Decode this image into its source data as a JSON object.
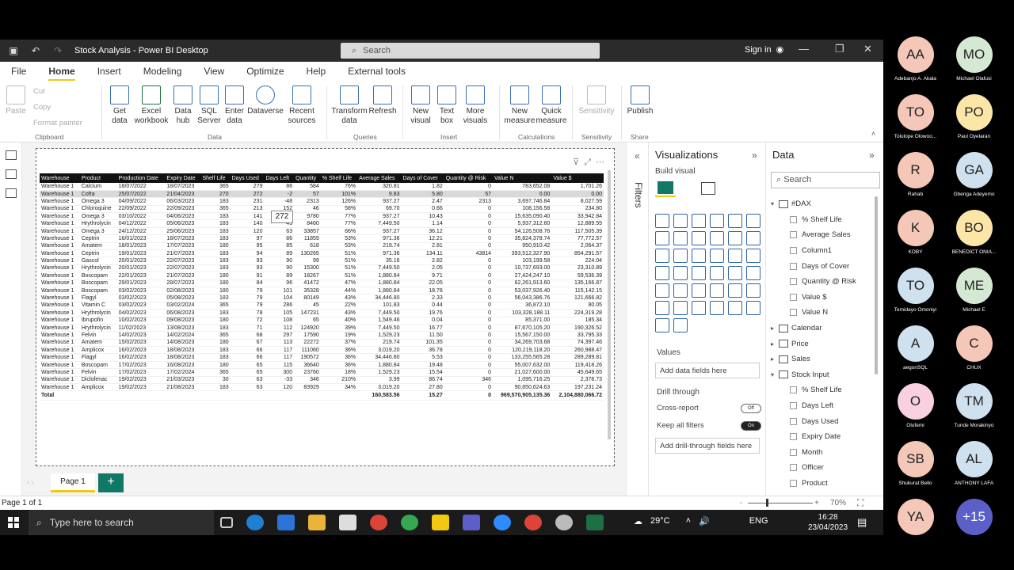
{
  "window": {
    "title": "Stock Analysis - Power BI Desktop",
    "search_placeholder": "Search",
    "signin": "Sign in"
  },
  "menu": [
    "File",
    "Home",
    "Insert",
    "Modeling",
    "View",
    "Optimize",
    "Help",
    "External tools"
  ],
  "ribbon": {
    "clipboard": {
      "paste": "Paste",
      "cut": "Cut",
      "copy": "Copy",
      "format_painter": "Format painter",
      "group": "Clipboard"
    },
    "data": {
      "get_data": "Get data",
      "excel": "Excel workbook",
      "data_hub": "Data hub",
      "sql": "SQL Server",
      "enter": "Enter data",
      "dataverse": "Dataverse",
      "recent": "Recent sources",
      "group": "Data"
    },
    "queries": {
      "transform": "Transform data",
      "refresh": "Refresh",
      "group": "Queries"
    },
    "insert": {
      "new_visual": "New visual",
      "text_box": "Text box",
      "more_visuals": "More visuals",
      "group": "Insert"
    },
    "calculations": {
      "new_measure": "New measure",
      "quick_measure": "Quick measure",
      "group": "Calculations"
    },
    "sensitivity": {
      "label": "Sensitivity",
      "group": "Sensitivity"
    },
    "share": {
      "publish": "Publish",
      "group": "Share"
    }
  },
  "table": {
    "headers": [
      "Warehouse",
      "Product",
      "Production Date",
      "Expiry Date",
      "Shelf Life",
      "Days Used",
      "Days Left",
      "Quantity",
      "% Shelf Life",
      "Average Sales",
      "Days of Cover",
      "Quantity @ Risk",
      "Value N",
      "Value $"
    ],
    "rows": [
      [
        "Warehouse 1",
        "Calcium",
        "18/07/2022",
        "18/07/2023",
        "365",
        "279",
        "86",
        "584",
        "76%",
        "320.81",
        "1.82",
        "0",
        "783,652.08",
        "1,701.26"
      ],
      [
        "Warehouse 1",
        "Cofta",
        "25/07/2022",
        "21/04/2023",
        "270",
        "272",
        "-2",
        "57",
        "101%",
        "9.83",
        "5.80",
        "57",
        "0.00",
        "0.00"
      ],
      [
        "Warehouse 1",
        "Omega 3",
        "04/09/2022",
        "06/03/2023",
        "183",
        "231",
        "-48",
        "2313",
        "126%",
        "937.27",
        "2.47",
        "2313",
        "3,697,746.84",
        "8,027.59"
      ],
      [
        "Warehouse 1",
        "Chloroquine",
        "22/09/2022",
        "22/09/2023",
        "365",
        "213",
        "152",
        "46",
        "58%",
        "69.70",
        "0.66",
        "0",
        "108,156.58",
        "234.80"
      ],
      [
        "Warehouse 1",
        "Omega 3",
        "03/10/2022",
        "04/06/2023",
        "183",
        "141",
        "42",
        "9780",
        "77%",
        "937.27",
        "10.43",
        "0",
        "15,635,090.40",
        "33,942.84"
      ],
      [
        "Warehouse 1",
        "Hrythrolycin",
        "04/12/2022",
        "05/06/2023",
        "183",
        "140",
        "43",
        "8460",
        "77%",
        "7,449.50",
        "1.14",
        "0",
        "5,937,312.60",
        "12,889.55"
      ],
      [
        "Warehouse 1",
        "Omega 3",
        "24/12/2022",
        "25/06/2023",
        "183",
        "120",
        "63",
        "33857",
        "66%",
        "937.27",
        "36.12",
        "0",
        "54,126,508.76",
        "117,505.39"
      ],
      [
        "Warehouse 1",
        "Ceptrin",
        "16/01/2023",
        "18/07/2023",
        "183",
        "97",
        "86",
        "11859",
        "53%",
        "971.36",
        "12.21",
        "0",
        "35,824,378.74",
        "77,772.57"
      ],
      [
        "Warehouse 1",
        "Amatem",
        "18/01/2023",
        "17/07/2023",
        "180",
        "95",
        "85",
        "618",
        "53%",
        "219.74",
        "2.81",
        "0",
        "950,910.42",
        "2,064.37"
      ],
      [
        "Warehouse 1",
        "Ceptrin",
        "19/01/2023",
        "21/07/2023",
        "183",
        "94",
        "89",
        "130265",
        "51%",
        "971.36",
        "134.11",
        "43814",
        "393,512,327.90",
        "854,291.57"
      ],
      [
        "Warehouse 1",
        "Gascol",
        "20/01/2023",
        "22/07/2023",
        "183",
        "93",
        "90",
        "99",
        "51%",
        "35.16",
        "2.82",
        "0",
        "103,199.58",
        "224.04"
      ],
      [
        "Warehouse 1",
        "Hrythrolycin",
        "20/01/2023",
        "22/07/2023",
        "183",
        "93",
        "90",
        "15300",
        "51%",
        "7,449.50",
        "2.05",
        "0",
        "10,737,693.00",
        "23,310.89"
      ],
      [
        "Warehouse 1",
        "Boscopam",
        "22/01/2023",
        "21/07/2023",
        "180",
        "91",
        "89",
        "18267",
        "51%",
        "1,880.84",
        "9.71",
        "0",
        "27,424,247.10",
        "59,536.39"
      ],
      [
        "Warehouse 1",
        "Boscopam",
        "29/01/2023",
        "28/07/2023",
        "180",
        "84",
        "96",
        "41472",
        "47%",
        "1,880.84",
        "22.05",
        "0",
        "62,261,913.60",
        "135,166.87"
      ],
      [
        "Warehouse 1",
        "Boscopam",
        "03/02/2023",
        "02/08/2023",
        "180",
        "79",
        "101",
        "35328",
        "44%",
        "1,880.84",
        "18.78",
        "0",
        "53,037,926.40",
        "115,142.15"
      ],
      [
        "Warehouse 1",
        "Flagyl",
        "03/02/2023",
        "05/08/2023",
        "183",
        "79",
        "104",
        "80149",
        "43%",
        "34,446.80",
        "2.33",
        "0",
        "56,043,386.76",
        "121,666.82"
      ],
      [
        "Warehouse 1",
        "Vitamin C",
        "03/02/2023",
        "03/02/2024",
        "365",
        "79",
        "286",
        "45",
        "22%",
        "101.83",
        "0.44",
        "0",
        "36,872.10",
        "80.05"
      ],
      [
        "Warehouse 1",
        "Hrythrolycin",
        "04/02/2023",
        "06/08/2023",
        "183",
        "78",
        "105",
        "147231",
        "43%",
        "7,449.50",
        "19.76",
        "0",
        "103,328,188.11",
        "224,319.28"
      ],
      [
        "Warehouse 1",
        "Ibrupofin",
        "10/02/2023",
        "09/08/2023",
        "180",
        "72",
        "108",
        "65",
        "40%",
        "1,549.46",
        "0.04",
        "0",
        "85,371.00",
        "185.34"
      ],
      [
        "Warehouse 1",
        "Hrythrolycin",
        "11/02/2023",
        "13/08/2023",
        "183",
        "71",
        "112",
        "124920",
        "39%",
        "7,449.50",
        "16.77",
        "0",
        "87,670,105.20",
        "190,326.52"
      ],
      [
        "Warehouse 1",
        "Felvin",
        "14/02/2023",
        "14/02/2024",
        "365",
        "68",
        "297",
        "17590",
        "19%",
        "1,529.23",
        "11.50",
        "0",
        "15,567,150.00",
        "33,795.33"
      ],
      [
        "Warehouse 1",
        "Amatem",
        "15/02/2023",
        "14/08/2023",
        "180",
        "67",
        "113",
        "22272",
        "37%",
        "219.74",
        "101.35",
        "0",
        "34,269,703.68",
        "74,397.46"
      ],
      [
        "Warehouse 1",
        "Amplicox",
        "16/02/2023",
        "18/08/2023",
        "183",
        "66",
        "117",
        "111060",
        "36%",
        "3,019.20",
        "36.78",
        "0",
        "120,219,118.20",
        "260,988.47"
      ],
      [
        "Warehouse 1",
        "Flagyl",
        "16/02/2023",
        "18/08/2023",
        "183",
        "66",
        "117",
        "190572",
        "36%",
        "34,446.80",
        "5.53",
        "0",
        "133,255,565.28",
        "289,289.81"
      ],
      [
        "Warehouse 1",
        "Boscopam",
        "17/02/2023",
        "16/08/2023",
        "180",
        "65",
        "115",
        "36640",
        "36%",
        "1,880.84",
        "19.48",
        "0",
        "55,007,632.00",
        "119,418.26"
      ],
      [
        "Warehouse 1",
        "Felvin",
        "17/02/2023",
        "17/02/2024",
        "365",
        "65",
        "300",
        "23760",
        "18%",
        "1,529.23",
        "15.54",
        "0",
        "21,027,600.00",
        "45,649.65"
      ],
      [
        "Warehouse 1",
        "Diclofenac",
        "19/02/2023",
        "21/03/2023",
        "30",
        "63",
        "-33",
        "346",
        "210%",
        "3.99",
        "86.74",
        "346",
        "1,095,716.25",
        "2,378.73"
      ],
      [
        "Warehouse 1",
        "Amplicox",
        "19/02/2023",
        "21/08/2023",
        "183",
        "63",
        "120",
        "83929",
        "34%",
        "3,019.20",
        "27.80",
        "0",
        "90,850,624.63",
        "197,231.24"
      ]
    ],
    "total": [
      "Total",
      "",
      "",
      "",
      "",
      "",
      "",
      "",
      "",
      "160,583.56",
      "15.27",
      "0",
      "969,570,905,135.36",
      "2,104,880,066.72"
    ]
  },
  "tooltip": "272",
  "pages": {
    "tab": "Page 1",
    "add": "+"
  },
  "status": {
    "page": "Page 1 of 1",
    "zoom": "70%"
  },
  "filters_label": "Filters",
  "viz": {
    "title": "Visualizations",
    "build": "Build visual",
    "values": "Values",
    "add_fields": "Add data fields here",
    "drill": "Drill through",
    "cross": "Cross-report",
    "cross_state": "Off",
    "keep": "Keep all filters",
    "keep_state": "On",
    "add_drill": "Add drill-through fields here"
  },
  "data_pane": {
    "title": "Data",
    "search": "Search",
    "items": [
      {
        "label": "#DAX",
        "level": "top",
        "expanded": true
      },
      {
        "label": "% Shelf Life",
        "level": "sub"
      },
      {
        "label": "Average Sales",
        "level": "sub"
      },
      {
        "label": "Column1",
        "level": "sub"
      },
      {
        "label": "Days of Cover",
        "level": "sub"
      },
      {
        "label": "Quantity @ Risk",
        "level": "sub"
      },
      {
        "label": "Value $",
        "level": "sub"
      },
      {
        "label": "Value N",
        "level": "sub"
      },
      {
        "label": "Calendar",
        "level": "top",
        "expanded": false
      },
      {
        "label": "Price",
        "level": "top",
        "expanded": false
      },
      {
        "label": "Sales",
        "level": "top",
        "expanded": false
      },
      {
        "label": "Stock Input",
        "level": "top",
        "expanded": true
      },
      {
        "label": "% Shelf Life",
        "level": "sub"
      },
      {
        "label": "Days Left",
        "level": "sub"
      },
      {
        "label": "Days Used",
        "level": "sub"
      },
      {
        "label": "Expiry Date",
        "level": "sub"
      },
      {
        "label": "Month",
        "level": "sub"
      },
      {
        "label": "Officer",
        "level": "sub"
      },
      {
        "label": "Product",
        "level": "sub"
      }
    ]
  },
  "taskbar": {
    "search": "Type here to search",
    "weather": "29°C",
    "lang": "ENG",
    "time": "16:28",
    "date": "23/04/2023"
  },
  "participants": [
    {
      "initials": "AA",
      "name": "Adebanjo A. Akala",
      "color": "#f4c7b8"
    },
    {
      "initials": "MO",
      "name": "Michael Olafusi",
      "color": "#d4e8d4"
    },
    {
      "initials": "TO",
      "name": "Tolulope Olowoo...",
      "color": "#f4c7b8"
    },
    {
      "initials": "PO",
      "name": "Paul Oyelaran",
      "color": "#fbe6a8"
    },
    {
      "initials": "R",
      "name": "Rahab",
      "color": "#f4c7b8"
    },
    {
      "initials": "GA",
      "name": "Gbenga Adeyemo",
      "color": "#cfe0ee"
    },
    {
      "initials": "K",
      "name": "KOBY",
      "color": "#f4c7b8"
    },
    {
      "initials": "BO",
      "name": "BENEDICT ONIA...",
      "color": "#fbe6a8"
    },
    {
      "initials": "TO",
      "name": "Temidayo Omoniyi",
      "color": "#cfe0ee"
    },
    {
      "initials": "ME",
      "name": "Michael E",
      "color": "#d4e8d4"
    },
    {
      "initials": "A",
      "name": "aegonSQL",
      "color": "#cfe0ee"
    },
    {
      "initials": "C",
      "name": "CHUX",
      "color": "#f4c7b8"
    },
    {
      "initials": "O",
      "name": "Olufemi",
      "color": "#f8d0e0"
    },
    {
      "initials": "TM",
      "name": "Tunde Morakinyo",
      "color": "#cfe0ee"
    },
    {
      "initials": "SB",
      "name": "Shukurat Bello",
      "color": "#f4c7b8"
    },
    {
      "initials": "AL",
      "name": "ANTHONY LAFA",
      "color": "#cfe0ee"
    },
    {
      "initials": "YA",
      "name": "",
      "color": "#f4c7b8"
    },
    {
      "initials": "+15",
      "name": "",
      "color": "#5b5fc7"
    }
  ]
}
